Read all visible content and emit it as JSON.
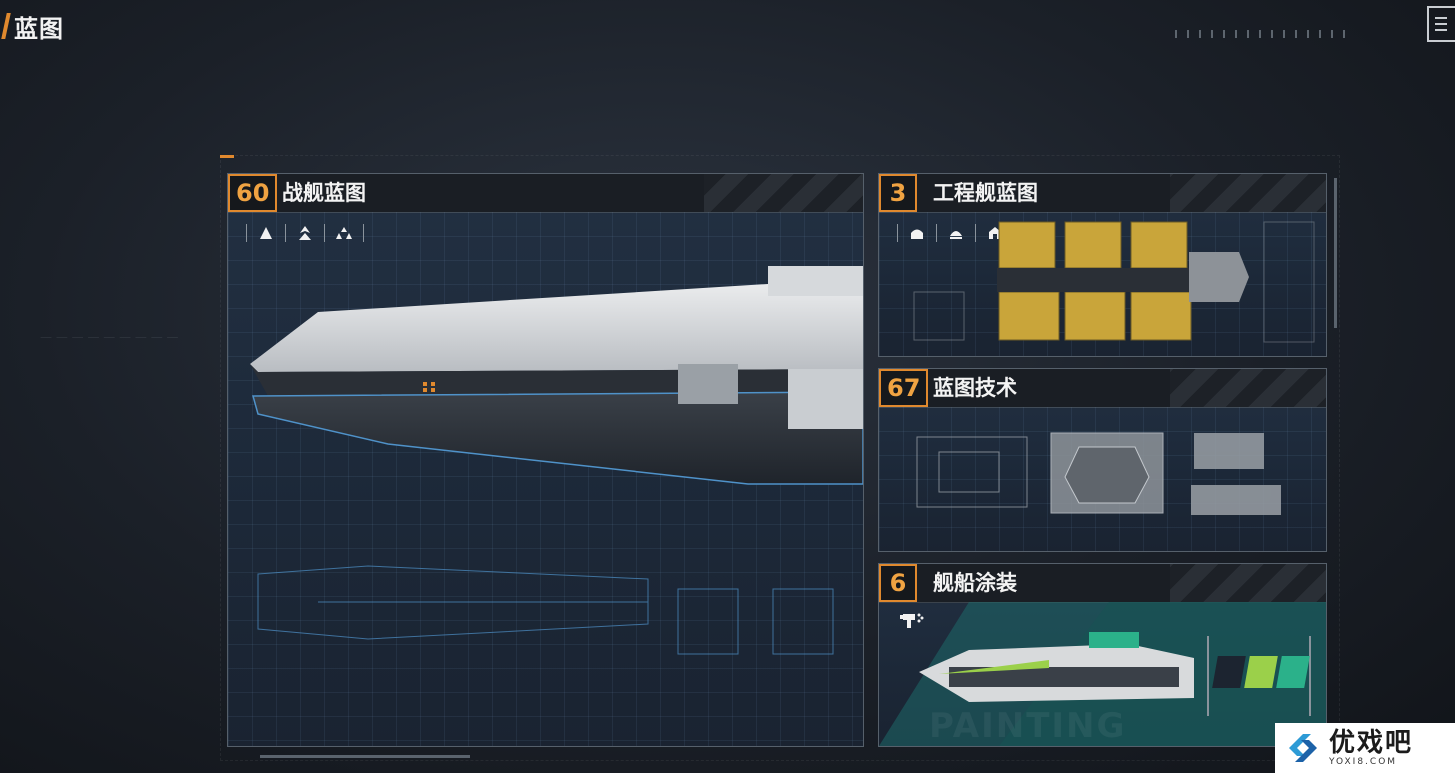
{
  "header": {
    "title": "蓝图"
  },
  "panels": {
    "warship": {
      "count": "60",
      "title": "战舰蓝图",
      "filters": [
        "frigate-icon",
        "destroyer-icon",
        "fleet-icon"
      ]
    },
    "engineering": {
      "count": "3",
      "title": "工程舰蓝图",
      "filters": [
        "miner-icon",
        "hauler-icon",
        "builder-icon"
      ]
    },
    "tech": {
      "count": "67",
      "title": "蓝图技术"
    },
    "paint": {
      "count": "6",
      "title": "舰船涂装",
      "swatches": [
        "#1c2430",
        "#9bd04a",
        "#2bb18a"
      ]
    }
  },
  "watermark": {
    "brand": "优戏吧",
    "domain": "YOXI8.COM"
  },
  "colors": {
    "accent": "#e0892e",
    "ship_hull": "#d9dcdf",
    "blueprint_line": "#4f92c9"
  }
}
